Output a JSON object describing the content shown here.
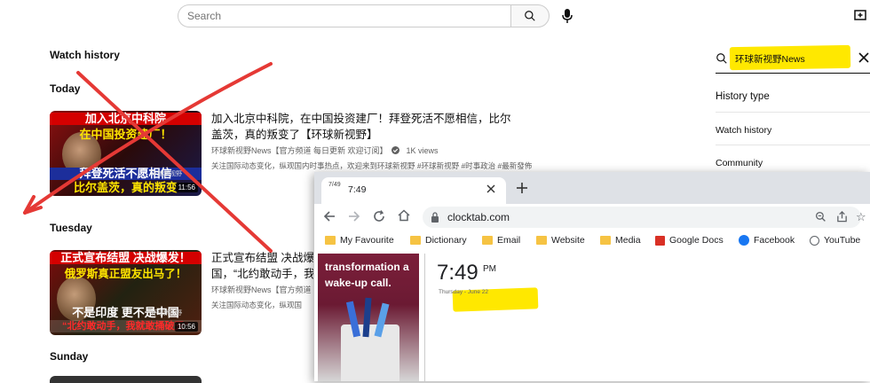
{
  "search": {
    "placeholder": "Search"
  },
  "page_title": "Watch history",
  "sections": {
    "today": "Today",
    "tuesday": "Tuesday",
    "sunday": "Sunday"
  },
  "videos": [
    {
      "title": "加入北京中科院，在中国投资建厂！拜登死活不愿相信，比尔盖茨，真的叛变了【环球新视野】",
      "channel": "环球新视野News【官方频道 每日更新 欢迎订阅】",
      "views": "1K views",
      "description": "关注国际动态变化，纵观国内时事热点，欢迎来到环球新视野 #环球新视野 #时事政治 #最新發佈",
      "duration": "11:56",
      "thumb_lines": [
        "加入北京中科院",
        "在中国投资建厂！",
        "拜登死活不愿相信",
        "比尔盖茨，真的叛变"
      ],
      "watermark": "环球新视野"
    },
    {
      "title": "正式宣布结盟 决战爆发，俄罗斯真正盟友出马了！中国，“北约敢动手，我就敢捅破天”",
      "title_line1": "正式宣布结盟 决战爆",
      "title_line2": "国，“北约敢动手，我",
      "channel": "环球新视野News【官方频道",
      "description": "关注国际动态变化，纵观国",
      "duration": "10:56",
      "thumb_lines": [
        "正式宣布结盟 决战爆发！",
        "俄罗斯真正盟友出马了！",
        "不是印度 更不是中国",
        "“北约敢动手，我就敢捅破天”"
      ],
      "watermark": "环球新视野"
    }
  ],
  "side_panel": {
    "search_value": "环球新视野News",
    "history_type": "History type",
    "watch_history": "Watch history",
    "community": "Community"
  },
  "browser": {
    "tab_favicon": "7/49",
    "tab_title": "7:49",
    "url": "clocktab.com",
    "bookmarks": [
      "My Favourite",
      "Dictionary",
      "Email",
      "Website",
      "Media",
      "Google Docs",
      "Facebook",
      "YouTube"
    ],
    "ad_text": "transformation a wake-up call.",
    "clock": {
      "time": "7:49",
      "ampm": "PM",
      "date": "Thursday - June 22"
    }
  },
  "colors": {
    "highlight": "#ffe800",
    "annotation_x": "#e53935"
  }
}
